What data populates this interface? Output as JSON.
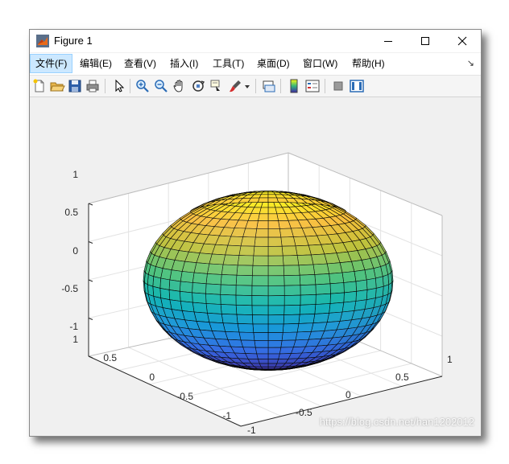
{
  "window": {
    "title": "Figure 1"
  },
  "menu": {
    "items": [
      "文件(F)",
      "编辑(E)",
      "查看(V)",
      "插入(I)",
      "工具(T)",
      "桌面(D)",
      "窗口(W)",
      "帮助(H)"
    ],
    "active_index": 0
  },
  "toolbar": {
    "icons": [
      "new-figure-icon",
      "open-file-icon",
      "save-icon",
      "print-icon",
      "select-arrow-icon",
      "zoom-in-icon",
      "zoom-out-icon",
      "pan-hand-icon",
      "rotate-3d-icon",
      "data-cursor-icon",
      "brush-icon",
      "brush-dropdown-icon",
      "link-plot-icon",
      "colorbar-icon",
      "legend-icon",
      "hide-plot-tools-icon",
      "show-plot-tools-icon"
    ]
  },
  "axes": {
    "z_ticks": [
      "1",
      "0.5",
      "0",
      "-0.5",
      "-1"
    ],
    "y_ticks": [
      "1",
      "0.5",
      "0",
      "-0.5",
      "-1"
    ],
    "x_ticks": [
      "1",
      "0.5",
      "0",
      "-0.5",
      "-1"
    ]
  },
  "plot": {
    "type": "surface",
    "shape": "ellipsoid",
    "colormap": "parula",
    "edge_color": "#000000"
  },
  "watermark": "https://blog.csdn.net/han1202012"
}
